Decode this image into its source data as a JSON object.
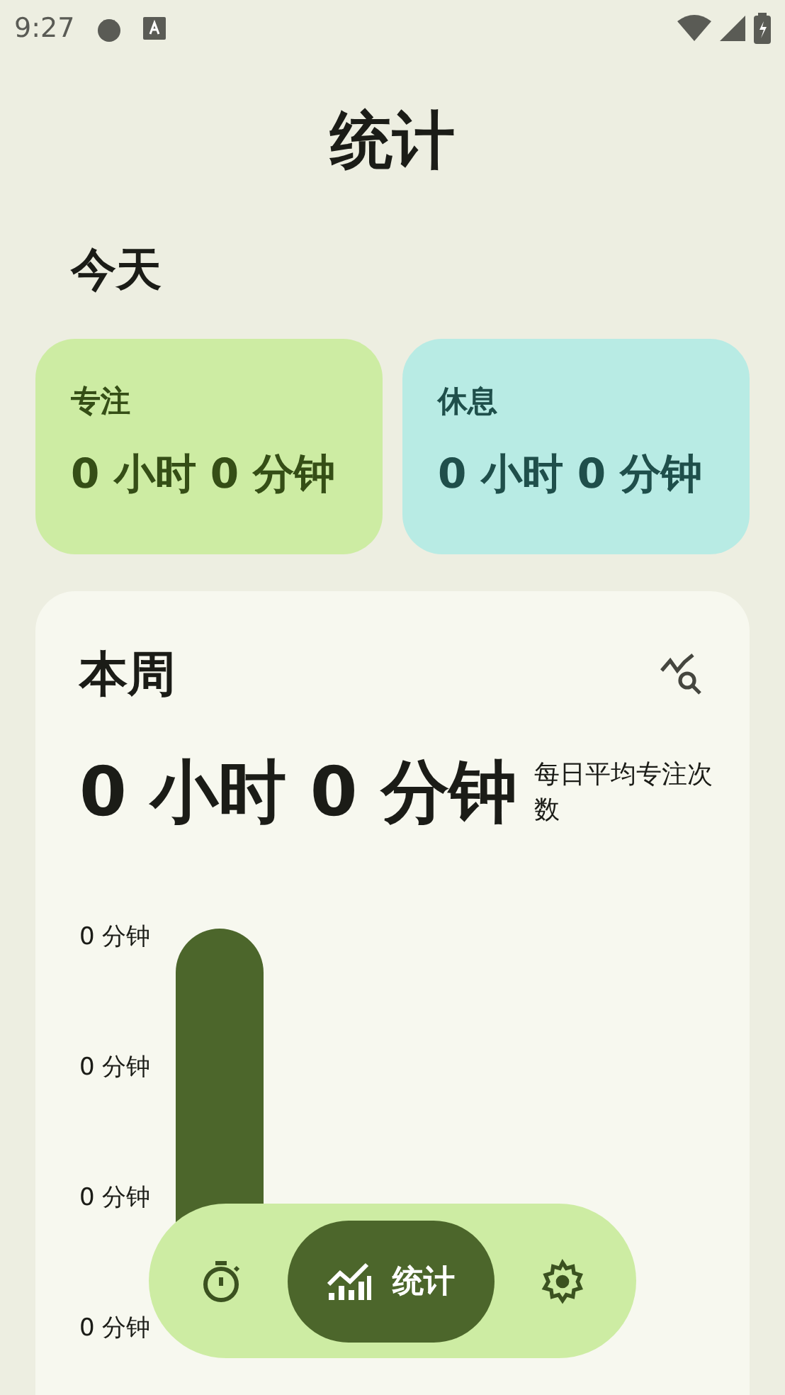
{
  "status_bar": {
    "time": "9:27"
  },
  "title": "统计",
  "today": {
    "heading": "今天",
    "cards": [
      {
        "kind": "focus",
        "label": "专注",
        "value": "0 小时 0 分钟"
      },
      {
        "kind": "break",
        "label": "休息",
        "value": "0 小时 0 分钟"
      }
    ]
  },
  "week": {
    "heading": "本周",
    "total": "0 小时 0 分钟",
    "caption": "每日平均专注次数",
    "y_labels": [
      "0 分钟",
      "0 分钟",
      "0 分钟",
      "0 分钟"
    ]
  },
  "nav": [
    {
      "kind": "timer",
      "selected": false
    },
    {
      "kind": "stats",
      "label": "统计",
      "selected": true
    },
    {
      "kind": "settings",
      "selected": false
    }
  ]
}
